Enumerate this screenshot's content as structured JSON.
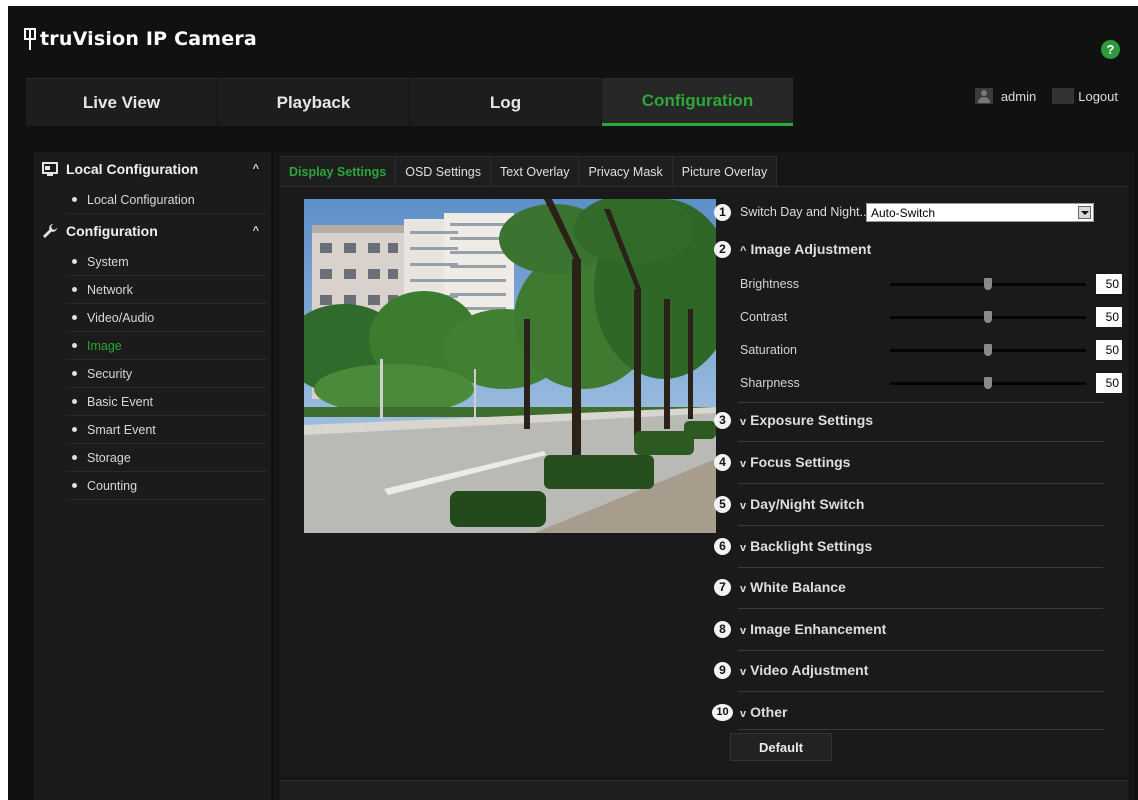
{
  "app": {
    "title": "truVision IP Camera",
    "help": "?"
  },
  "nav": {
    "tabs": [
      "Live View",
      "Playback",
      "Log",
      "Configuration"
    ],
    "active_index": 3
  },
  "user": {
    "name": "admin",
    "logout": "Logout"
  },
  "sidebar": {
    "sections": [
      {
        "title": "Local Configuration",
        "items": [
          "Local Configuration"
        ]
      },
      {
        "title": "Configuration",
        "items": [
          "System",
          "Network",
          "Video/Audio",
          "Image",
          "Security",
          "Basic Event",
          "Smart Event",
          "Storage",
          "Counting"
        ]
      }
    ],
    "active_item": "Image"
  },
  "subtabs": {
    "items": [
      "Display Settings",
      "OSD Settings",
      "Text Overlay",
      "Privacy Mask",
      "Picture Overlay"
    ],
    "active_index": 0
  },
  "switch_day_night": {
    "label": "Switch Day and Night...",
    "value": "Auto-Switch"
  },
  "image_adjustment": {
    "title": "Image Adjustment",
    "sliders": [
      {
        "label": "Brightness",
        "value": "50",
        "fraction": 0.5
      },
      {
        "label": "Contrast",
        "value": "50",
        "fraction": 0.5
      },
      {
        "label": "Saturation",
        "value": "50",
        "fraction": 0.5
      },
      {
        "label": "Sharpness",
        "value": "50",
        "fraction": 0.5
      }
    ]
  },
  "sections": [
    "Exposure Settings",
    "Focus Settings",
    "Day/Night Switch",
    "Backlight Settings",
    "White Balance",
    "Image Enhancement",
    "Video Adjustment",
    "Other"
  ],
  "callouts": [
    "1",
    "2",
    "3",
    "4",
    "5",
    "6",
    "7",
    "8",
    "9",
    "10"
  ],
  "default_button": "Default",
  "colors": {
    "accent": "#2aa83a",
    "background": "#111111"
  }
}
